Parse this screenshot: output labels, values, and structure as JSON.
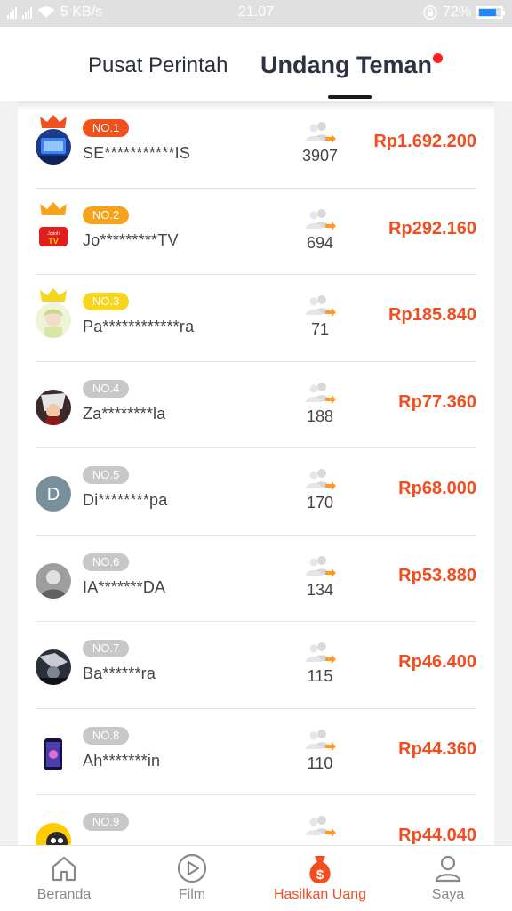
{
  "status_bar": {
    "network_speed": "5 KB/s",
    "time": "21.07",
    "battery": "72%",
    "battery_level": 0.72
  },
  "header": {
    "tabs": [
      {
        "label": "Pusat Perintah",
        "active": false
      },
      {
        "label": "Undang Teman",
        "active": true
      }
    ]
  },
  "colors": {
    "accent": "#f24d1f",
    "rank1": "#f0501a",
    "rank2": "#f7a21b",
    "rank3": "#f7d51d",
    "rank_other": "#c7c7c7"
  },
  "ranking": [
    {
      "rank": "NO.1",
      "name": "SE***********IS",
      "invites": "3907",
      "amount": "Rp1.692.200",
      "avatar": "tv-blue",
      "crown": true,
      "badge_color": "#f0501a"
    },
    {
      "rank": "NO.2",
      "name": "Jo*********TV",
      "invites": "694",
      "amount": "Rp292.160",
      "avatar": "tv-red",
      "crown": true,
      "badge_color": "#f7a21b"
    },
    {
      "rank": "NO.3",
      "name": "Pa************ra",
      "invites": "71",
      "amount": "Rp185.840",
      "avatar": "anime-green",
      "crown": true,
      "badge_color": "#f7d51d"
    },
    {
      "rank": "NO.4",
      "name": "Za********la",
      "invites": "188",
      "amount": "Rp77.360",
      "avatar": "anime-dark",
      "crown": false,
      "badge_color": "#c7c7c7"
    },
    {
      "rank": "NO.5",
      "name": "Di********pa",
      "invites": "170",
      "amount": "Rp68.000",
      "avatar": "letter-d",
      "avatar_letter": "D",
      "crown": false,
      "badge_color": "#c7c7c7"
    },
    {
      "rank": "NO.6",
      "name": "IA*******DA",
      "invites": "134",
      "amount": "Rp53.880",
      "avatar": "gray-photo",
      "crown": false,
      "badge_color": "#c7c7c7"
    },
    {
      "rank": "NO.7",
      "name": "Ba******ra",
      "invites": "115",
      "amount": "Rp46.400",
      "avatar": "dark-photo",
      "crown": false,
      "badge_color": "#c7c7c7"
    },
    {
      "rank": "NO.8",
      "name": "Ah*******in",
      "invites": "110",
      "amount": "Rp44.360",
      "avatar": "phone-photo",
      "crown": false,
      "badge_color": "#c7c7c7"
    },
    {
      "rank": "NO.9",
      "name": "",
      "invites": "",
      "amount": "Rp44.040",
      "avatar": "yellow-cartoon",
      "crown": false,
      "badge_color": "#c7c7c7"
    }
  ],
  "bottom_nav": [
    {
      "label": "Beranda",
      "icon": "home-icon",
      "active": false
    },
    {
      "label": "Film",
      "icon": "play-icon",
      "active": false
    },
    {
      "label": "Hasilkan Uang",
      "icon": "money-bag-icon",
      "active": true
    },
    {
      "label": "Saya",
      "icon": "user-icon",
      "active": false
    }
  ]
}
